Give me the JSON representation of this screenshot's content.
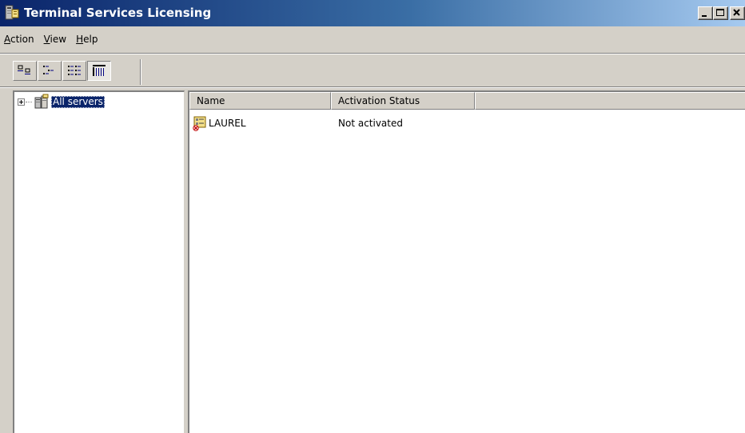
{
  "window": {
    "title": "Terminal Services Licensing"
  },
  "menu": {
    "items": [
      {
        "accel": "A",
        "rest": "ction"
      },
      {
        "accel": "V",
        "rest": "iew"
      },
      {
        "accel": "H",
        "rest": "elp"
      }
    ]
  },
  "toolbar": {
    "buttons": [
      {
        "icon": "large-icons-view-icon",
        "pressed": false
      },
      {
        "icon": "small-icons-view-icon",
        "pressed": false
      },
      {
        "icon": "list-view-icon",
        "pressed": false
      },
      {
        "icon": "details-view-icon",
        "pressed": true
      }
    ]
  },
  "tree": {
    "root_label": "All servers",
    "root_icon": "server-group-icon"
  },
  "list": {
    "columns": [
      "Name",
      "Activation Status"
    ],
    "rows": [
      {
        "name": "LAUREL",
        "status": "Not activated",
        "icon": "license-server-error-icon"
      }
    ]
  },
  "colors": {
    "title_start": "#0a246a",
    "title_end": "#a6caf0",
    "face": "#d4d0c8",
    "selection": "#0a246a"
  }
}
